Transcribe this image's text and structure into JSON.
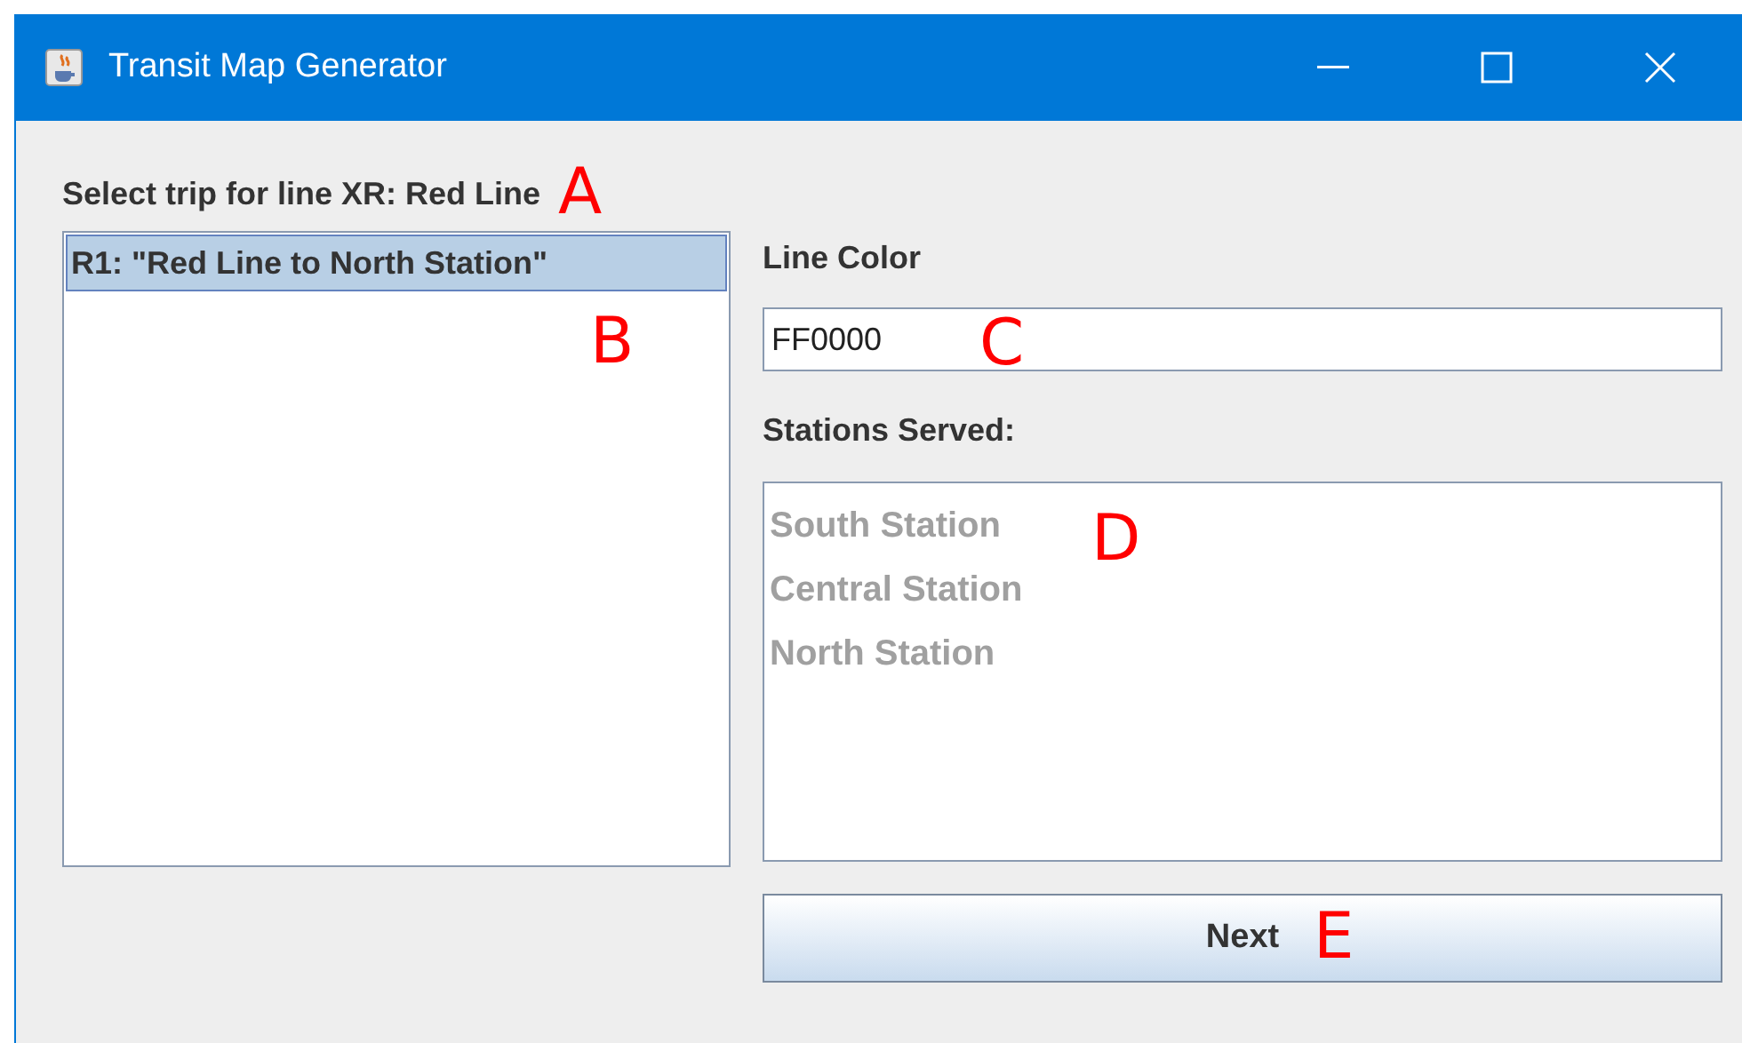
{
  "window": {
    "title": "Transit Map Generator"
  },
  "prompt": {
    "label": "Select trip for line XR: Red Line",
    "annotation": "A"
  },
  "trips": {
    "items": [
      {
        "label": "R1: \"Red Line to North Station\"",
        "selected": true
      }
    ],
    "annotation": "B"
  },
  "line_color": {
    "label": "Line Color",
    "value": "FF0000",
    "annotation": "C"
  },
  "stations": {
    "label": "Stations Served:",
    "disabled": true,
    "items": [
      "South Station",
      "Central Station",
      "North Station"
    ],
    "annotation": "D"
  },
  "next_button": {
    "label": "Next",
    "annotation": "E"
  }
}
